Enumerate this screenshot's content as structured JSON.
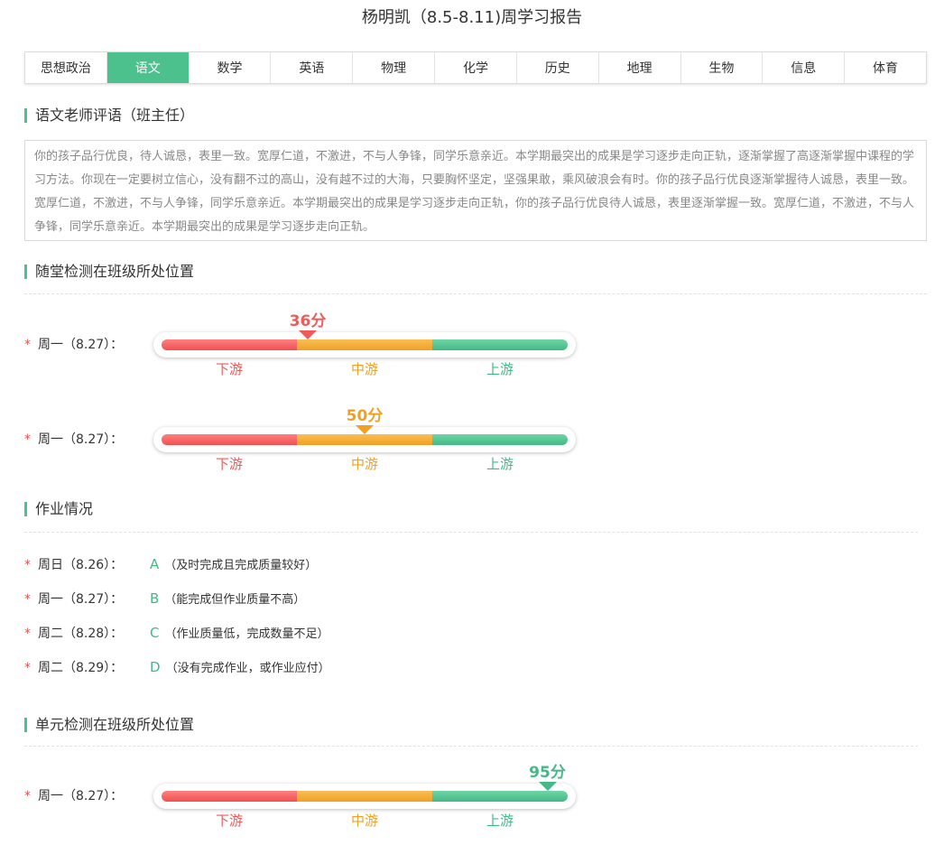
{
  "title": "杨明凯（8.5-8.11)周学习报告",
  "tabs": [
    {
      "label": "思想政治"
    },
    {
      "label": "语文",
      "active": true
    },
    {
      "label": "数学"
    },
    {
      "label": "英语"
    },
    {
      "label": "物理"
    },
    {
      "label": "化学"
    },
    {
      "label": "历史"
    },
    {
      "label": "地理"
    },
    {
      "label": "生物"
    },
    {
      "label": "信息"
    },
    {
      "label": "体育"
    }
  ],
  "comment": {
    "heading": "语文老师评语（班主任）",
    "text": "你的孩子品行优良，待人诚恳，表里一致。宽厚仁道，不激进，不与人争锋，同学乐意亲近。本学期最突出的成果是学习逐步走向正轨，逐渐掌握了高逐渐掌握中课程的学习方法。你现在一定要树立信心，没有翻不过的高山，没有越不过的大海，只要胸怀坚定，坚强果敢，乘风破浪会有时。你的孩子品行优良逐渐掌握待人诚恳，表里一致。宽厚仁道，不激进，不与人争锋，同学乐意亲近。本学期最突出的成果是学习逐步走向正轨，你的孩子品行优良待人诚恳，表里逐渐掌握一致。宽厚仁道，不激进，不与人争锋，同学乐意亲近。本学期最突出的成果是学习逐步走向正轨。"
  },
  "zones": {
    "low": "下游",
    "mid": "中游",
    "high": "上游"
  },
  "colors": {
    "accent": "#4cc08d",
    "low": "#f05a5a",
    "mid": "#f0a024",
    "high": "#45b887"
  },
  "class_test": {
    "heading": "随堂检测在班级所处位置",
    "rows": [
      {
        "label": "周一（8.27）：",
        "score": 36,
        "score_text": "36分",
        "level": "low"
      },
      {
        "label": "周一（8.27）：",
        "score": 50,
        "score_text": "50分",
        "level": "mid"
      }
    ]
  },
  "homework": {
    "heading": "作业情况",
    "rows": [
      {
        "day": "周日（8.26）：",
        "grade": "A",
        "desc": "（及时完成且完成质量较好）"
      },
      {
        "day": "周一（8.27）：",
        "grade": "B",
        "desc": "（能完成但作业质量不高）"
      },
      {
        "day": "周二（8.28）：",
        "grade": "C",
        "desc": "（作业质量低，完成数量不足）"
      },
      {
        "day": "周二（8.29）：",
        "grade": "D",
        "desc": "（没有完成作业，或作业应付）"
      }
    ]
  },
  "unit_test": {
    "heading": "单元检测在班级所处位置",
    "rows": [
      {
        "label": "周一（8.27）：",
        "score": 95,
        "score_text": "95分",
        "level": "high"
      }
    ]
  }
}
